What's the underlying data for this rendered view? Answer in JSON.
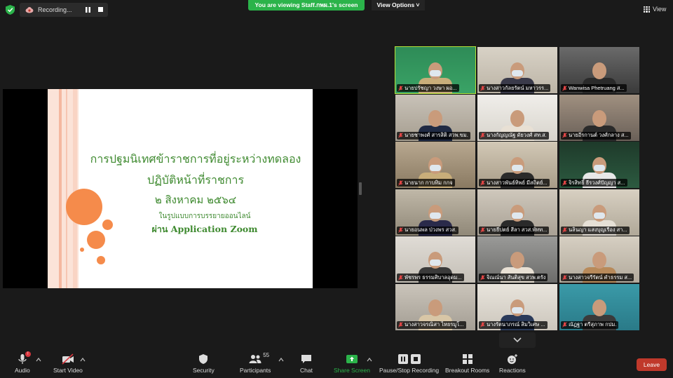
{
  "top_bar": {
    "recording_label": "Recording...",
    "viewing_banner": "You are viewing Staff.กพผ.1's screen",
    "view_options_label": "View Options",
    "view_label": "View"
  },
  "slide": {
    "title_line1": "การปฐมนิเทศข้าราชการที่อยู่ระหว่างทดลอง",
    "title_line2": "ปฏิบัติหน้าที่ราชการ",
    "date": "๒ สิงหาคม ๒๕๖๔",
    "subtitle_line1": "ในรูปแบบการบรรยายออนไลน์",
    "subtitle_line2": "ผ่าน Application Zoom",
    "text_color": "#3f8a30",
    "circle_color": "#f58b4b"
  },
  "participants": [
    {
      "name": "นายปรัชญา วงษา ผอ...",
      "active": true
    },
    {
      "name": "นางสาวกัลยรัตน์ มหาวรร...",
      "active": false
    },
    {
      "name": "Wanwisa Phetruang ส...",
      "active": false
    },
    {
      "name": "นายชาพงศ์ สารสิติ สวพ.ขม.",
      "active": false
    },
    {
      "name": "นางกัญญณัฐ ดัยวงศ์ สท.ส.",
      "active": false
    },
    {
      "name": "นายอีรกานต์ วงศ์กลาง ส...",
      "active": false
    },
    {
      "name": "นายนาก กาบทิม กกจ",
      "active": false
    },
    {
      "name": "นางสาวพันธ์ทิพย์ มีสถิตย์...",
      "active": false
    },
    {
      "name": "จิรสิทธิ์ ธีรวงศ์ปัญญา ส...",
      "active": false
    },
    {
      "name": "นายอนพล ป่วงพร สวส.",
      "active": false
    },
    {
      "name": "นายธีปตย์ สีลา สวส.พัทท...",
      "active": false
    },
    {
      "name": "นลินญา แสงบุญเรือง สา...",
      "active": false
    },
    {
      "name": "พัชรพร ธรรมศิบาลอุดม...",
      "active": false
    },
    {
      "name": "จิณณ์นา สันติสุข สวพ.ตรัง",
      "active": false
    },
    {
      "name": "นางสาวจรีรัตน์ คำธรรม ส...",
      "active": false
    },
    {
      "name": "นางสาวจรณิสา ไหยรมูโ...",
      "active": false
    },
    {
      "name": "นางรัตนาภรณ์ สิมวิเศษ ...",
      "active": false
    },
    {
      "name": "ณัฏฐา ตรีสุภาพ กปม.",
      "active": false
    }
  ],
  "toolbar": {
    "audio_label": "Audio",
    "audio_badge": "!",
    "video_label": "Start Video",
    "security_label": "Security",
    "participants_label": "Participants",
    "participants_count": "55",
    "chat_label": "Chat",
    "share_label": "Share Screen",
    "recording_label": "Pause/Stop Recording",
    "breakout_label": "Breakout Rooms",
    "reactions_label": "Reactions",
    "leave_label": "Leave",
    "share_color": "#2bb34a",
    "leave_color": "#c0392b"
  }
}
